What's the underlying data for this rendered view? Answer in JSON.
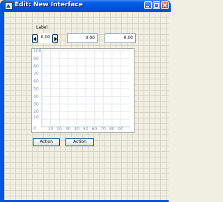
{
  "window": {
    "title": "Edit: New Interface",
    "titlebar_color": "#0054e3"
  },
  "label": {
    "text": "Label"
  },
  "spinner": {
    "value": "0.00"
  },
  "number_fields": [
    {
      "value": "0.00"
    },
    {
      "value": "0.00"
    }
  ],
  "chart_data": {
    "type": "line",
    "x_ticks": [
      "10",
      "20",
      "30",
      "40",
      "50",
      "60",
      "70",
      "80",
      "90"
    ],
    "y_ticks": [
      "100",
      "90",
      "80",
      "70",
      "60",
      "50",
      "40",
      "30",
      "20",
      "10"
    ],
    "corner_label": "0",
    "xlim": [
      0,
      100
    ],
    "ylim": [
      0,
      100
    ],
    "grid": true,
    "series": []
  },
  "buttons": [
    {
      "label": "Action"
    },
    {
      "label": "Action"
    }
  ],
  "icons": {
    "title": "application-icon",
    "minimize": "minimize-icon",
    "maximize": "maximize-icon",
    "close": "close-icon",
    "spin_left": "arrow-left-icon",
    "spin_right": "arrow-right-icon"
  }
}
